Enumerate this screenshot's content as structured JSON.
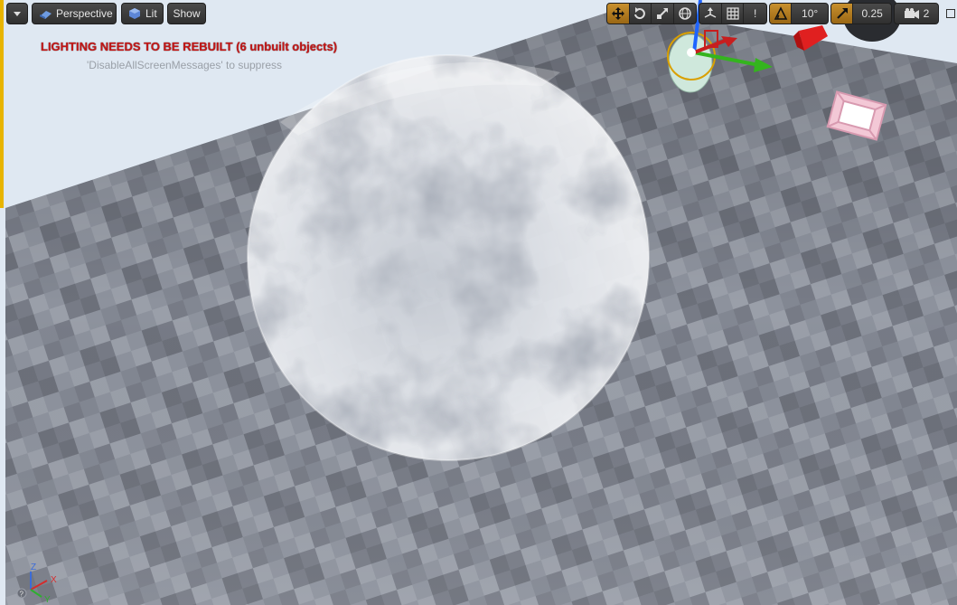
{
  "toolbar": {
    "menu_icon": "chevron-down-icon",
    "perspective_label": "Perspective",
    "lit_label": "Lit",
    "show_label": "Show",
    "rotation_snap": "10°",
    "scale_snap": "0.25",
    "camera_speed": "2"
  },
  "messages": {
    "warning": "LIGHTING NEEDS TO BE REBUILT (6 unbuilt objects)",
    "hint": "'DisableAllScreenMessages' to suppress"
  },
  "axis_indicator": {
    "z": "Z",
    "x": "X",
    "y": "Y"
  },
  "colors": {
    "sky": "#dfe8f2",
    "floor_light": "#8e939e",
    "floor_dark": "#6f737d",
    "warning_red": "#c41717",
    "active_orange": "#c8902e"
  }
}
